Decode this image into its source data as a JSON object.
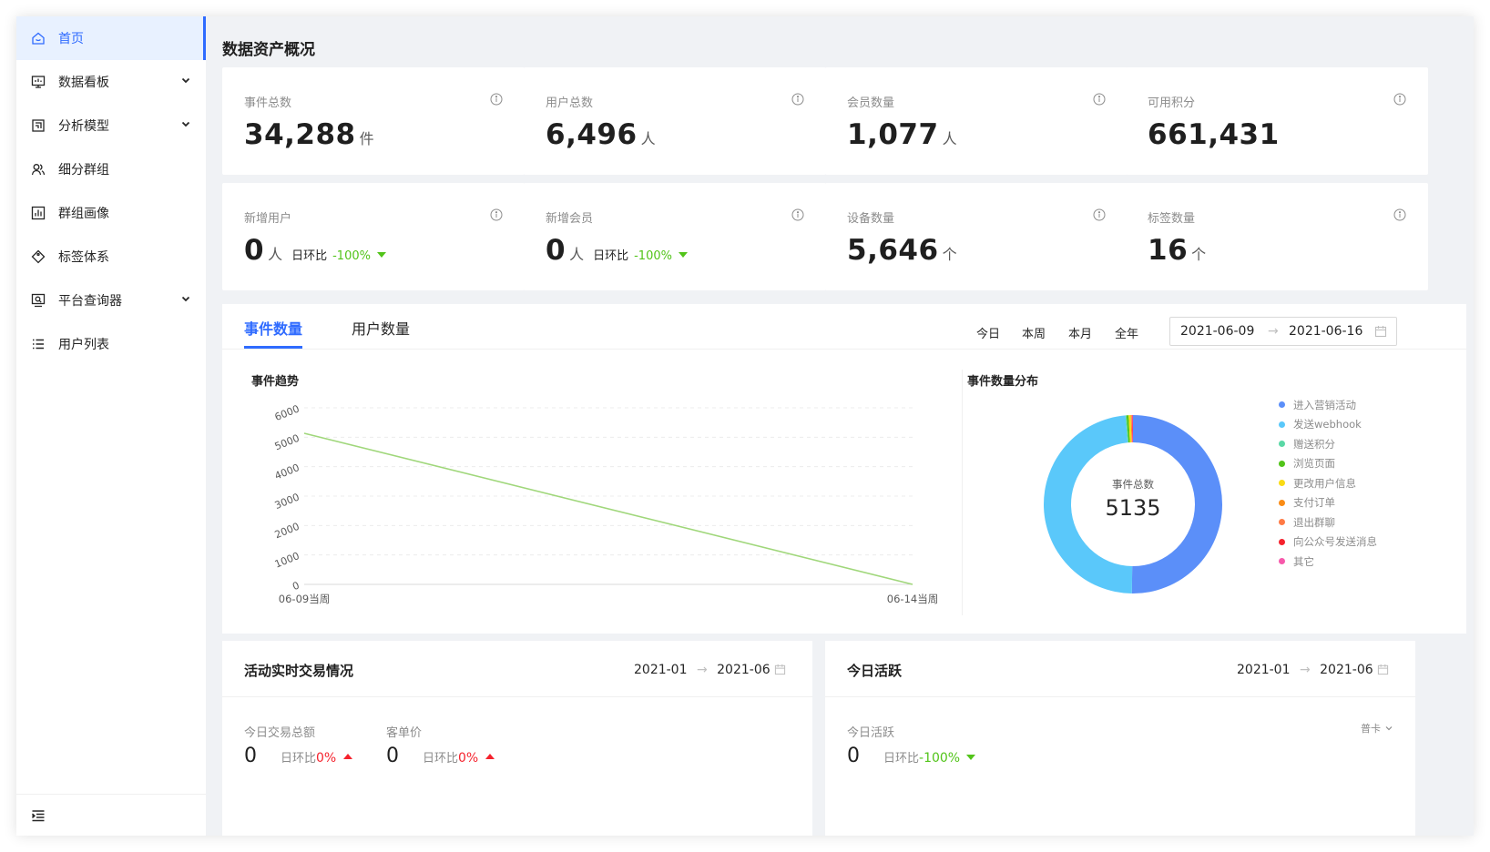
{
  "sidebar": {
    "items": [
      {
        "label": "首页",
        "icon": "home-icon",
        "active": true
      },
      {
        "label": "数据看板",
        "icon": "dashboard-icon",
        "expandable": true
      },
      {
        "label": "分析模型",
        "icon": "analysis-model-icon",
        "expandable": true
      },
      {
        "label": "细分群组",
        "icon": "user-group-icon"
      },
      {
        "label": "群组画像",
        "icon": "bar-chart-icon"
      },
      {
        "label": "标签体系",
        "icon": "tag-icon"
      },
      {
        "label": "平台查询器",
        "icon": "query-icon",
        "expandable": true
      },
      {
        "label": "用户列表",
        "icon": "list-icon"
      }
    ],
    "footer_icon": "menu-collapse-icon"
  },
  "page": {
    "title": "数据资产概况"
  },
  "stats": [
    {
      "label": "事件总数",
      "value": "34,288",
      "unit": "件"
    },
    {
      "label": "用户总数",
      "value": "6,496",
      "unit": "人"
    },
    {
      "label": "会员数量",
      "value": "1,077",
      "unit": "人"
    },
    {
      "label": "可用积分",
      "value": "661,431",
      "unit": ""
    },
    {
      "label": "新增用户",
      "value": "0",
      "unit": "人",
      "cmp_label": "日环比",
      "cmp_value": "-100%"
    },
    {
      "label": "新增会员",
      "value": "0",
      "unit": "人",
      "cmp_label": "日环比",
      "cmp_value": "-100%"
    },
    {
      "label": "设备数量",
      "value": "5,646",
      "unit": "个"
    },
    {
      "label": "标签数量",
      "value": "16",
      "unit": "个"
    }
  ],
  "chart_panel": {
    "tabs": [
      {
        "label": "事件数量",
        "active": true
      },
      {
        "label": "用户数量",
        "active": false
      }
    ],
    "periods": [
      "今日",
      "本周",
      "本月",
      "全年"
    ],
    "date_start": "2021-06-09",
    "date_end": "2021-06-16",
    "arrow": "→"
  },
  "chart_data": [
    {
      "type": "line",
      "title": "事件趋势",
      "x": [
        "06-09当周",
        "06-14当周"
      ],
      "series": [
        {
          "values": [
            5135,
            0
          ]
        }
      ],
      "ylim": [
        0,
        6000
      ],
      "yticks": [
        "0",
        "1000",
        "2000",
        "3000",
        "4000",
        "5000",
        "6000"
      ],
      "grid": true,
      "color": "#a0d77b"
    },
    {
      "type": "pie",
      "title": "事件数量分布",
      "center_label": "事件总数",
      "center_value": "5135",
      "legend_position": "right",
      "categories": [
        "进入营销活动",
        "发送webhook",
        "赠送积分",
        "浏览页面",
        "更改用户信息",
        "支付订单",
        "退出群聊",
        "向公众号发送消息",
        "其它"
      ],
      "values": [
        2580,
        2490,
        10,
        20,
        20,
        5,
        5,
        5,
        5
      ],
      "colors": [
        "#5b8ff9",
        "#5ac8fa",
        "#5ad8a6",
        "#52c41a",
        "#fadb14",
        "#fa8c16",
        "#ff7a45",
        "#f5222d",
        "#f759ab"
      ]
    }
  ],
  "activity_card": {
    "title": "活动实时交易情况",
    "range_start": "2021-01",
    "range_end": "2021-06",
    "metrics": [
      {
        "label": "今日交易总额",
        "value": "0",
        "cmp_label": "日环比",
        "cmp_value": "0%"
      },
      {
        "label": "客单价",
        "value": "0",
        "cmp_label": "日环比",
        "cmp_value": "0%"
      }
    ]
  },
  "active_card": {
    "title": "今日活跃",
    "range_start": "2021-01",
    "range_end": "2021-06",
    "metric": {
      "label": "今日活跃",
      "value": "0",
      "cmp_label": "日环比",
      "cmp_value": "-100%"
    },
    "select_value": "普卡"
  }
}
